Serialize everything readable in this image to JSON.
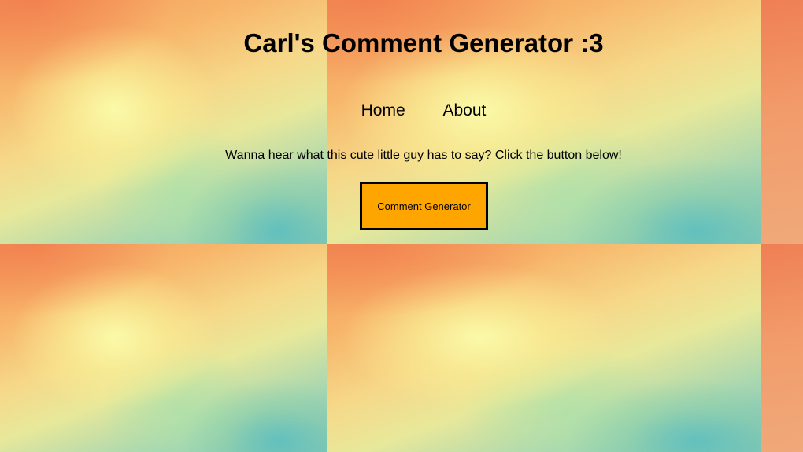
{
  "header": {
    "title": "Carl's Comment Generator :3"
  },
  "nav": {
    "items": [
      {
        "label": "Home"
      },
      {
        "label": "About"
      }
    ]
  },
  "main": {
    "intro": "Wanna hear what this cute little guy has to say? Click the button below!",
    "button_label": "Comment Generator",
    "button_color": "#ffa500"
  }
}
